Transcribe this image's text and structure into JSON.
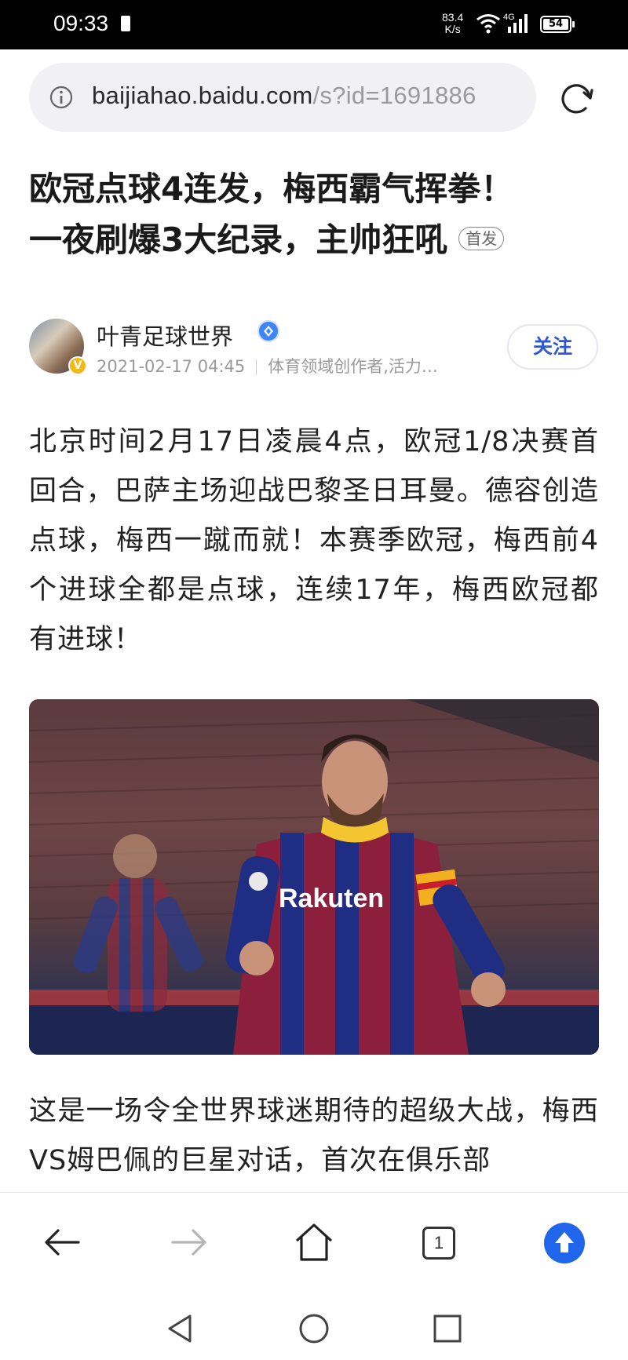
{
  "status_bar": {
    "time": "09:33",
    "net_speed_value": "83.4",
    "net_speed_unit": "K/s",
    "network_type": "4G",
    "battery": "54"
  },
  "address_bar": {
    "host": "baijiahao.baidu.com",
    "path": "/s?id=1691886"
  },
  "article": {
    "title_line1": "欧冠点球4连发，梅西霸气挥拳！",
    "title_line2": "一夜刷爆3大纪录，主帅狂吼",
    "badge": "首发",
    "author": {
      "name": "叶青足球世界",
      "date": "2021-02-17 04:45",
      "description": "体育领域创作者,活力…",
      "follow_label": "关注"
    },
    "paragraph1": "北京时间2月17日凌晨4点，欧冠1/8决赛首回合，巴萨主场迎战巴黎圣日耳曼。德容创造点球，梅西一蹴而就！本赛季欧冠，梅西前4个进球全都是点球，连续17年，梅西欧冠都有进球！",
    "photo_sponsor_text": "Rakuten",
    "paragraph2": "这是一场令全世界球迷期待的超级大战，梅西VS姆巴佩的巨星对话，首次在俱乐部"
  },
  "toolbar": {
    "tab_count": "1"
  },
  "colors": {
    "accent": "#2166ea",
    "follow_text": "#2f57d6"
  }
}
